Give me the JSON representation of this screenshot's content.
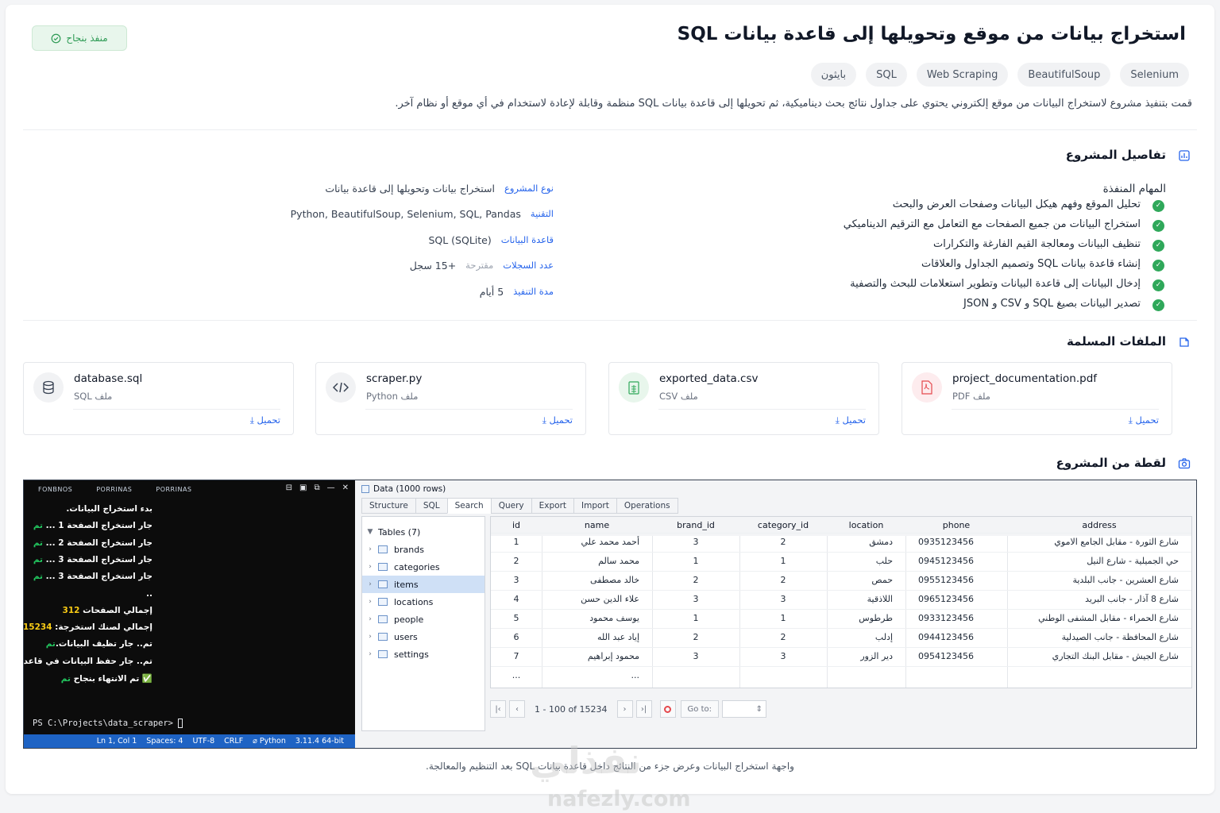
{
  "header": {
    "title": "استخراج بيانات من موقع وتحويلها إلى قاعدة بيانات SQL",
    "status": "منفذ بنجاح",
    "tags": [
      "Selenium",
      "BeautifulSoup",
      "Web Scraping",
      "SQL",
      "بايثون"
    ],
    "intro": "قمت بتنفيذ مشروع لاستخراج البيانات من موقع إلكتروني يحتوي على جداول نتائج بحث ديناميكية، ثم تحويلها إلى قاعدة بيانات SQL منظمة وقابلة لإعادة لاستخدام في أي موقع أو نظام آخر."
  },
  "details_section": {
    "title": "تفاصيل المشروع",
    "tasks_heading": "المهام المنفذة",
    "tasks": [
      "تحليل الموقع وفهم هيكل البيانات وصفحات العرض والبحث",
      "استخراج البيانات من جميع الصفحات مع التعامل مع الترقيم الديناميكي",
      "تنظيف البيانات ومعالجة القيم الفارغة والتكرارات",
      "إنشاء قاعدة بيانات SQL وتصميم الجداول والعلاقات",
      "إدخال البيانات إلى قاعدة البيانات وتطوير استعلامات للبحث والتصفية",
      "تصدير البيانات بصيغ SQL و CSV و JSON"
    ],
    "info": [
      {
        "label": "نوع المشروع",
        "value": "استخراج بيانات وتحويلها إلى قاعدة بيانات",
        "note": ""
      },
      {
        "label": "التقنية",
        "value": "Python, BeautifulSoup, Selenium, SQL, Pandas",
        "note": ""
      },
      {
        "label": "قاعدة البيانات",
        "value": "SQL (SQLite)",
        "note": ""
      },
      {
        "label": "عدد السجلات",
        "value": "+15 سجل",
        "note": "مقترحة"
      },
      {
        "label": "مدة التنفيذ",
        "value": "5 أيام",
        "note": ""
      }
    ]
  },
  "files_section": {
    "title": "الملفات المسلمة",
    "download_label": "تحميل",
    "files": [
      {
        "name": "project_documentation.pdf",
        "type": "ملف PDF",
        "icon": "pdf-file-icon",
        "color": "#e5484d"
      },
      {
        "name": "exported_data.csv",
        "type": "ملف CSV",
        "icon": "csv-file-icon",
        "color": "#2fa85a"
      },
      {
        "name": "scraper.py",
        "type": "ملف Python",
        "icon": "code-icon",
        "color": "#374151"
      },
      {
        "name": "database.sql",
        "type": "ملف SQL",
        "icon": "database-icon",
        "color": "#374151"
      }
    ]
  },
  "screenshot_section": {
    "title": "لقطة من المشروع",
    "caption": "واجهة استخراج البيانات وعرض جزء من النتائج داخل قاعدة بيانات SQL بعد التنظيم والمعالجة."
  },
  "terminal": {
    "tabs": [
      "FONBNOS",
      "PORRINAS",
      "PORRINAS"
    ],
    "lines": [
      {
        "text": "بدء استخراج البيانات.",
        "suffix": "",
        "suffix_class": ""
      },
      {
        "text": "جار استخراج الصفحة 1 ... ",
        "suffix": "تم",
        "suffix_class": "ok"
      },
      {
        "text": "جار استخراج الصفحة 2 ... ",
        "suffix": "تم",
        "suffix_class": "ok"
      },
      {
        "text": "جار استخراج الصفحة 3 ... ",
        "suffix": "تم",
        "suffix_class": "ok"
      },
      {
        "text": "جار استخراج الصفحة 3 ... ",
        "suffix": "تم",
        "suffix_class": "ok"
      },
      {
        "text": "..",
        "suffix": "",
        "suffix_class": "num"
      },
      {
        "text": "إجمالي الصفحات ",
        "suffix": "312",
        "suffix_class": "num"
      },
      {
        "text": "إجمالي لصنك استخرجة: ",
        "suffix": "15234",
        "suffix_class": "num"
      },
      {
        "text": "تم.. جار تظيف البيانات.",
        "suffix": "تم",
        "suffix_class": "ok"
      },
      {
        "text": "تم.. جار حفظ البيانات في قاعدة البيانات...",
        "suffix": "تم",
        "suffix_class": "ok"
      },
      {
        "text": "✅ تم الانتهاء بنجاح ",
        "suffix": "تم",
        "suffix_class": "ok"
      }
    ],
    "prompt": "PS C:\\Projects\\data_scraper> ",
    "status": [
      "Ln 1, Col 1",
      "Spaces: 4",
      "UTF-8",
      "CRLF",
      "⌀ Python",
      "3.11.4 64-bit"
    ]
  },
  "db": {
    "title": "Data (1000 rows)",
    "tabs": [
      "Structure",
      "SQL",
      "Search",
      "Query",
      "Export",
      "Import",
      "Operations"
    ],
    "active_tab": "Search",
    "tables_label": "Tables (7)",
    "tables": [
      "brands",
      "categories",
      "items",
      "locations",
      "people",
      "users",
      "settings"
    ],
    "selected_table": "items",
    "columns": [
      "id",
      "name",
      "brand_id",
      "category_id",
      "location",
      "phone",
      "address"
    ],
    "rows": [
      [
        "1",
        "أحمد محمد علي",
        "3",
        "2",
        "دمشق",
        "0935123456",
        "شارع الثورة - مقابل الجامع الاموي"
      ],
      [
        "2",
        "محمد سالم",
        "1",
        "1",
        "حلب",
        "0945123456",
        "حي الجميلية - شارع النيل"
      ],
      [
        "3",
        "خالد مصطفى",
        "2",
        "2",
        "حمص",
        "0955123456",
        "شارع العشرين - جانب البلدية"
      ],
      [
        "4",
        "علاء الدين حسن",
        "3",
        "3",
        "اللاذقية",
        "0965123456",
        "شارع 8 آذار - جانب البريد"
      ],
      [
        "5",
        "يوسف محمود",
        "1",
        "1",
        "طرطوس",
        "0933123456",
        "شارع الحمراء - مقابل المشفى الوطني"
      ],
      [
        "6",
        "إياد عبد الله",
        "2",
        "2",
        "إدلب",
        "0944123456",
        "شارع المحافظة - جانب الصيدلية"
      ],
      [
        "7",
        "محمود إبراهيم",
        "3",
        "3",
        "دير الزور",
        "0954123456",
        "شارع الجيش - مقابل البنك التجاري"
      ],
      [
        "...",
        "...",
        "",
        "",
        "",
        "",
        ""
      ]
    ],
    "pager": {
      "range": "1 - 100 of 15234",
      "goto_label": "Go to:"
    }
  },
  "watermark": {
    "arabic": "نفذلي",
    "latin": "nafezly.com"
  }
}
